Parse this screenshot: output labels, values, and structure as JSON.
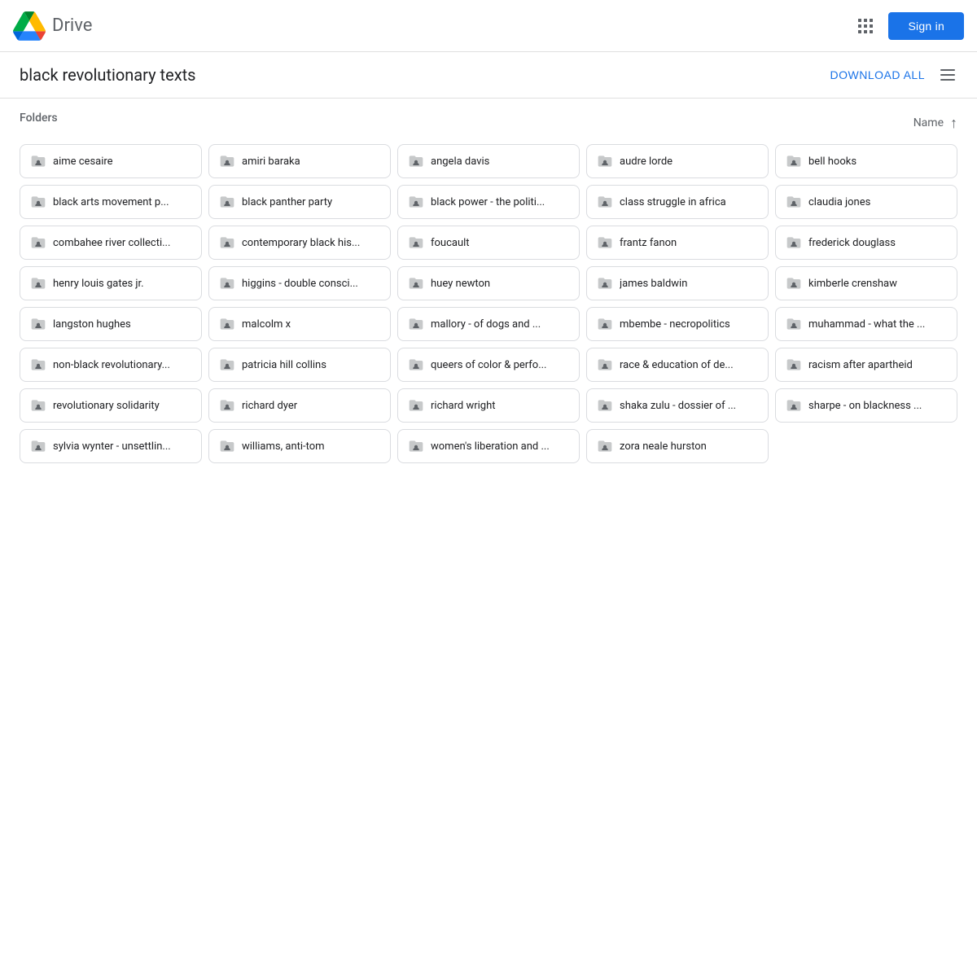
{
  "header": {
    "logo_text": "Drive",
    "sign_in_label": "Sign in",
    "apps_icon": "apps-icon"
  },
  "title_bar": {
    "page_title": "black revolutionary texts",
    "download_all_label": "DOWNLOAD ALL",
    "list_view_icon": "list-view-icon"
  },
  "folders_section": {
    "label": "Folders",
    "sort_label": "Name",
    "folders": [
      {
        "id": 1,
        "name": "aime cesaire"
      },
      {
        "id": 2,
        "name": "amiri baraka"
      },
      {
        "id": 3,
        "name": "angela davis"
      },
      {
        "id": 4,
        "name": "audre lorde"
      },
      {
        "id": 5,
        "name": "bell hooks"
      },
      {
        "id": 6,
        "name": "black arts movement p..."
      },
      {
        "id": 7,
        "name": "black panther party"
      },
      {
        "id": 8,
        "name": "black power - the politi..."
      },
      {
        "id": 9,
        "name": "class struggle in africa"
      },
      {
        "id": 10,
        "name": "claudia jones"
      },
      {
        "id": 11,
        "name": "combahee river collecti..."
      },
      {
        "id": 12,
        "name": "contemporary black his..."
      },
      {
        "id": 13,
        "name": "foucault"
      },
      {
        "id": 14,
        "name": "frantz fanon"
      },
      {
        "id": 15,
        "name": "frederick douglass"
      },
      {
        "id": 16,
        "name": "henry louis gates jr."
      },
      {
        "id": 17,
        "name": "higgins - double consci..."
      },
      {
        "id": 18,
        "name": "huey newton"
      },
      {
        "id": 19,
        "name": "james baldwin"
      },
      {
        "id": 20,
        "name": "kimberle crenshaw"
      },
      {
        "id": 21,
        "name": "langston hughes"
      },
      {
        "id": 22,
        "name": "malcolm x"
      },
      {
        "id": 23,
        "name": "mallory - of dogs and ..."
      },
      {
        "id": 24,
        "name": "mbembe - necropolitics"
      },
      {
        "id": 25,
        "name": "muhammad - what the ..."
      },
      {
        "id": 26,
        "name": "non-black revolutionary..."
      },
      {
        "id": 27,
        "name": "patricia hill collins"
      },
      {
        "id": 28,
        "name": "queers of color & perfo..."
      },
      {
        "id": 29,
        "name": "race & education of de..."
      },
      {
        "id": 30,
        "name": "racism after apartheid"
      },
      {
        "id": 31,
        "name": "revolutionary solidarity"
      },
      {
        "id": 32,
        "name": "richard dyer"
      },
      {
        "id": 33,
        "name": "richard wright"
      },
      {
        "id": 34,
        "name": "shaka zulu - dossier of ..."
      },
      {
        "id": 35,
        "name": "sharpe - on blackness ..."
      },
      {
        "id": 36,
        "name": "sylvia wynter - unsettlin..."
      },
      {
        "id": 37,
        "name": "williams, anti-tom"
      },
      {
        "id": 38,
        "name": "women's liberation and ..."
      },
      {
        "id": 39,
        "name": "zora neale hurston"
      }
    ]
  }
}
